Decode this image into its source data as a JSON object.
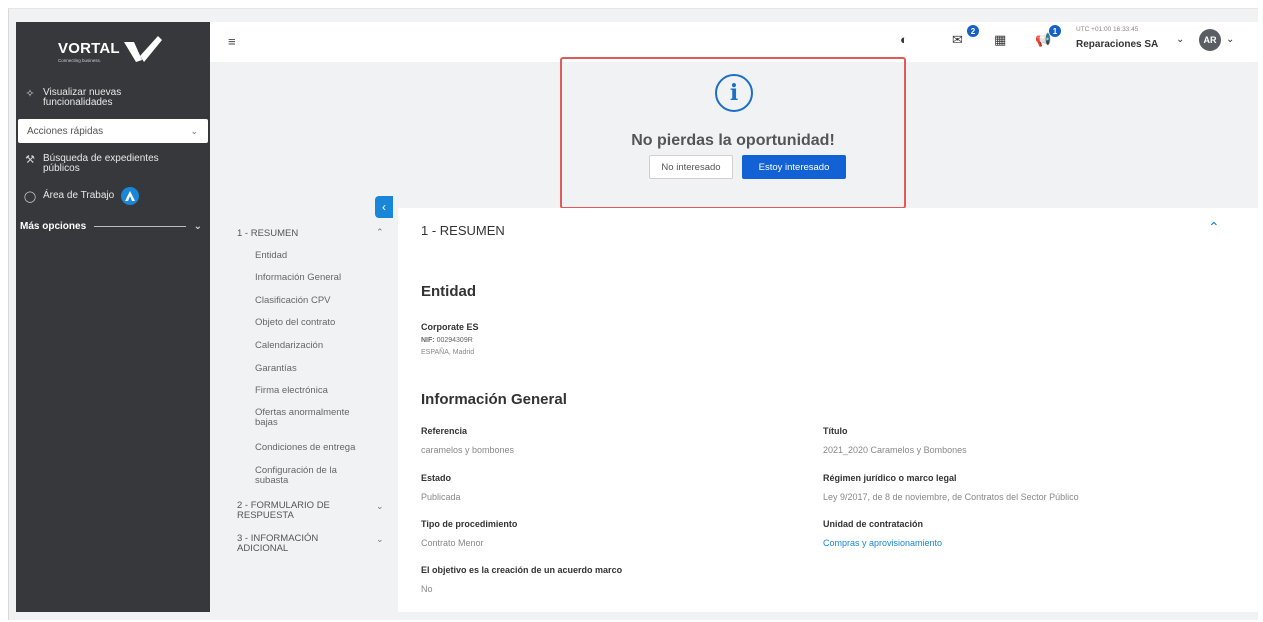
{
  "brand": {
    "name": "VORTAL",
    "tagline": "Connecting business."
  },
  "sidebar": {
    "items": [
      {
        "label": "Visualizar nuevas funcionalidades",
        "icon": "sparkle-icon"
      },
      {
        "label": "Búsqueda de expedientes públicos",
        "icon": "gavel-icon"
      },
      {
        "label": "Área de Trabajo",
        "icon": "workspace-icon"
      }
    ],
    "quick_actions": "Acciones rápidas",
    "more_options": "Más opciones"
  },
  "topbar": {
    "mail_count": "2",
    "announce_count": "1",
    "user_meta": "UTC +01:00 16:33:45",
    "company": "Reparaciones SA",
    "avatar_initials": "AR"
  },
  "promo": {
    "title": "No pierdas la oportunidad!",
    "no_label": "No interesado",
    "yes_label": "Estoy interesado"
  },
  "leftnav": {
    "sections": [
      {
        "label": "1 - RESUMEN",
        "expanded": true,
        "items": [
          "Entidad",
          "Información General",
          "Clasificación CPV",
          "Objeto del contrato",
          "Calendarización",
          "Garantías",
          "Firma electrónica",
          "Ofertas anormalmente bajas",
          "Condiciones de entrega",
          "Configuración de la subasta"
        ]
      },
      {
        "label": "2 - FORMULARIO DE RESPUESTA",
        "expanded": false
      },
      {
        "label": "3 - INFORMACIÓN ADICIONAL",
        "expanded": false
      }
    ]
  },
  "content": {
    "section_title": "1 - RESUMEN",
    "entity": {
      "heading": "Entidad",
      "name": "Corporate ES",
      "nif_label": "NIF:",
      "nif_value": "00294309R",
      "location": "ESPAÑA, Madrid"
    },
    "general": {
      "heading": "Información General",
      "fields": [
        {
          "label": "Referencia",
          "value": "caramelos y bombones"
        },
        {
          "label": "Título",
          "value": "2021_2020 Caramelos y Bombones"
        },
        {
          "label": "Estado",
          "value": "Publicada"
        },
        {
          "label": "Régimen jurídico o marco legal",
          "value": "Ley 9/2017, de 8 de noviembre, de Contratos del Sector Público"
        },
        {
          "label": "Tipo de procedimiento",
          "value": "Contrato Menor"
        },
        {
          "label": "Unidad de contratación",
          "value": "Compras y aprovisionamiento"
        },
        {
          "label": "El objetivo es la creación de un acuerdo marco",
          "value": "No"
        }
      ]
    }
  },
  "colors": {
    "accent": "#1a86d8",
    "primary_button": "#1262d6",
    "sidebar_bg": "#36383b",
    "highlight_border": "#e05a5a"
  }
}
